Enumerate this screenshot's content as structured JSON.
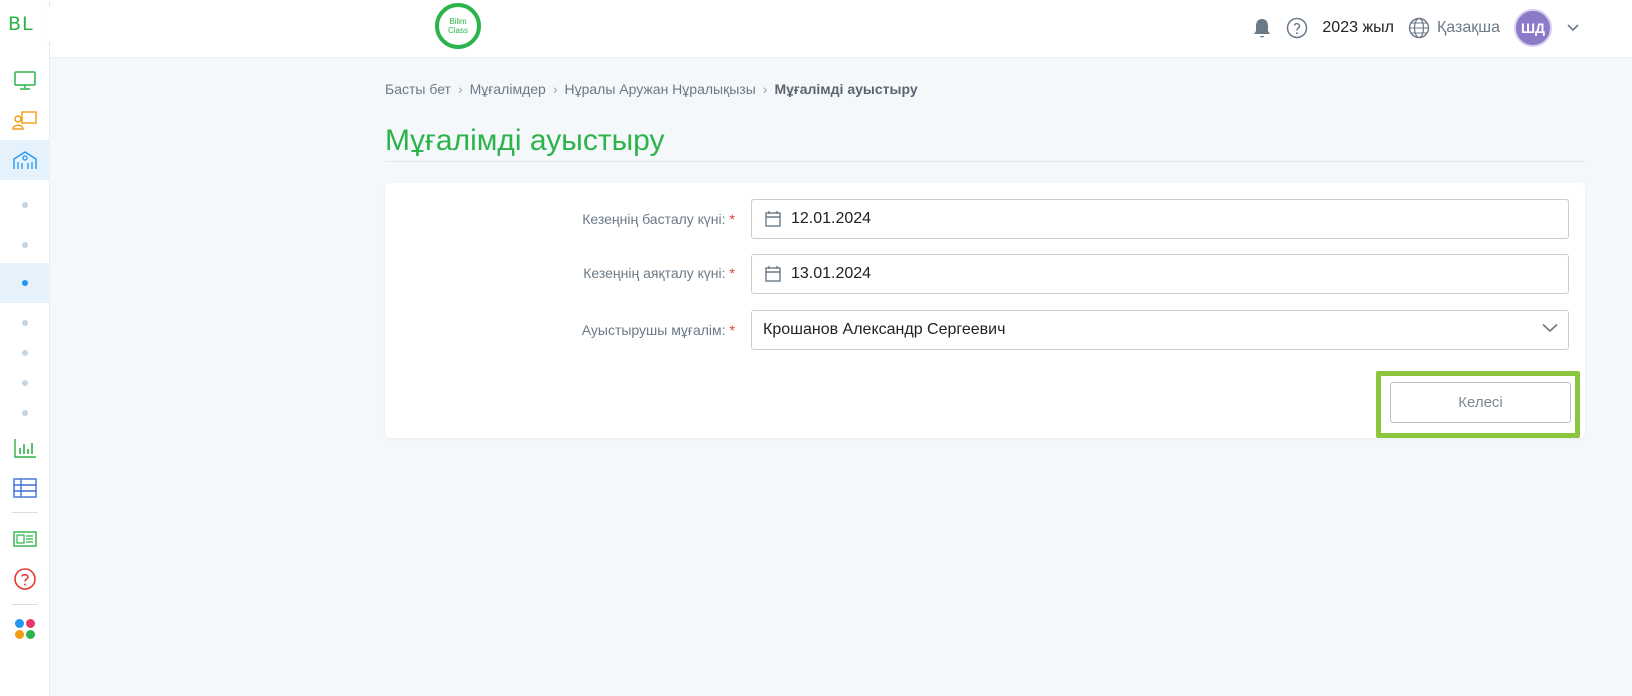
{
  "sidebar": {
    "logo_text": "BL",
    "items": [
      {
        "name": "monitor-icon",
        "color": "#2cb34a"
      },
      {
        "name": "teacher-board-icon",
        "color": "#f39c12"
      },
      {
        "name": "school-icon",
        "color": "#2196f3"
      },
      {
        "name": "chart-icon",
        "color": "#2cb34a"
      },
      {
        "name": "table-icon",
        "color": "#3f6fd8"
      },
      {
        "name": "news-icon",
        "color": "#2cb34a"
      },
      {
        "name": "help-icon",
        "color": "#e53935"
      },
      {
        "name": "apps-icon",
        "color": "#2196f3"
      }
    ]
  },
  "header": {
    "brand_line1": "Bilim",
    "brand_line2": "Class",
    "year": "2023 жыл",
    "language": "Қазақша",
    "avatar_initials": "ШД"
  },
  "breadcrumb": {
    "items": [
      "Басты бет",
      "Мұғалімдер",
      "Нұралы Аружан Нұралықызы"
    ],
    "current": "Мұғалімді ауыстыру"
  },
  "page": {
    "title": "Мұғалімді ауыстыру"
  },
  "form": {
    "start_label": "Кезеңнің басталу күні:",
    "start_value": "12.01.2024",
    "end_label": "Кезеңнің аяқталу күні:",
    "end_value": "13.01.2024",
    "teacher_label": "Ауыстырушы мұғалім:",
    "teacher_value": "Крошанов Александр Сергеевич",
    "required_mark": "*",
    "next_label": "Келесі"
  },
  "colors": {
    "accent": "#2cb34a",
    "highlight": "#8cc63f",
    "avatar": "#8c79c7"
  }
}
